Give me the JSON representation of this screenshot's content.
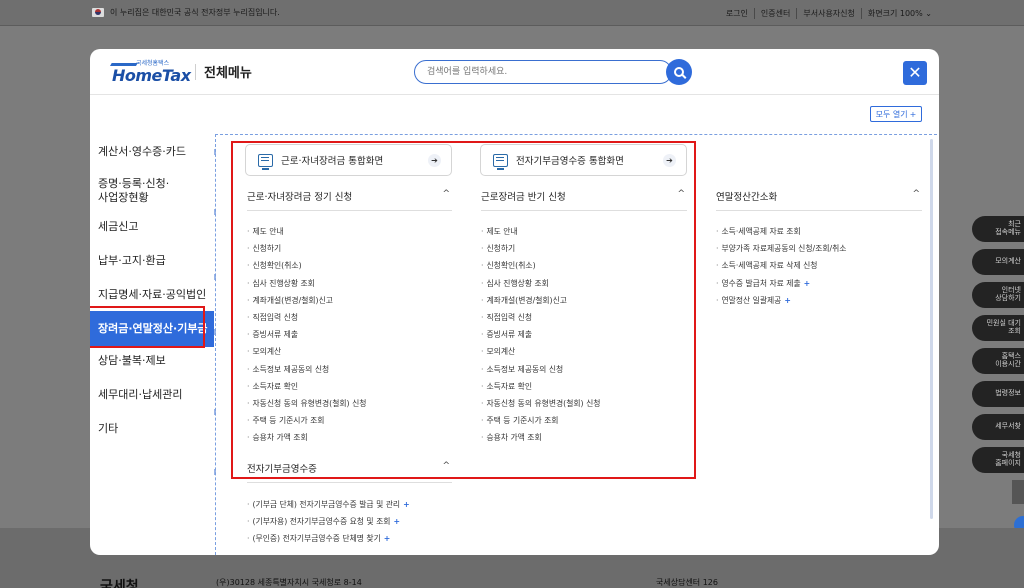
{
  "topbar": {
    "gov_notice": "이 누리집은 대한민국 공식 전자정부 누리집입니다.",
    "links": [
      "로그인",
      "인증센터",
      "부서사용자신청",
      "화면크기 100% ⌄"
    ]
  },
  "modal": {
    "brand_sub": "국세청홈택스",
    "brand_name": "HomeTax",
    "title": "전체메뉴",
    "search_placeholder": "검색어를 입력하세요.",
    "close": "✕",
    "open_all": "모두 열기",
    "open_all_plus": "+"
  },
  "nav": [
    "계산서·영수증·카드",
    "증명·등록·신청·\n사업장현황",
    "세금신고",
    "납부·고지·환급",
    "지급명세·자료·공익법인",
    "장려금·연말정산·기부금",
    "상담·불복·제보",
    "세무대리·납세관리",
    "기타"
  ],
  "cards": {
    "card1": "근로·자녀장려금 통합화면",
    "card2": "전자기부금영수증 통합화면",
    "arrow": "➔"
  },
  "sections": {
    "s1": {
      "title": "근로·자녀장려금 정기 신청",
      "caret": "^",
      "items": [
        "제도 안내",
        "신청하기",
        "신청확인(취소)",
        "심사 진행상황 조회",
        "계좌개설(변경/철회)신고",
        "직접입력 신청",
        "증빙서류 제출",
        "모의계산",
        "소득정보 제공동의 신청",
        "소득자료 확인",
        "자동신청 동의 유형변경(철회) 신청",
        "주택 등 기준시가 조회",
        "승용차 가액 조회"
      ]
    },
    "s2": {
      "title": "근로장려금 반기 신청",
      "caret": "^",
      "items": [
        "제도 안내",
        "신청하기",
        "신청확인(취소)",
        "심사 진행상황 조회",
        "계좌개설(변경/철회)신고",
        "직접입력 신청",
        "증빙서류 제출",
        "모의계산",
        "소득정보 제공동의 신청",
        "소득자료 확인",
        "자동신청 동의 유형변경(철회) 신청",
        "주택 등 기준시가 조회",
        "승용차 가액 조회"
      ]
    },
    "s3": {
      "title": "연말정산간소화",
      "caret": "^",
      "items": [
        "소득·세액공제 자료 조회",
        "부양가족 자료제공동의 신청/조회/취소",
        "소득·세액공제 자료 삭제 신청",
        "영수증 발급처 자료 제출",
        "연말정산 일괄제공"
      ],
      "plus_flags": [
        false,
        false,
        false,
        true,
        true
      ]
    },
    "s4": {
      "title": "전자기부금영수증",
      "caret": "^",
      "items": [
        "(기부금 단체) 전자기부금영수증 발급 및 관리",
        "(기부자용) 전자기부금영수증 요청 및 조회",
        "(무인증) 전자기부금영수증 단체명 찾기"
      ],
      "plus_flags": [
        true,
        true,
        true
      ]
    },
    "plus": "+"
  },
  "quick_menu": [
    "최근\n접속메뉴",
    "모의계산",
    "인터넷\n상담하기",
    "민원실 대기\n조회",
    "홈택스\n이용시간",
    "법령정보",
    "세무서찾",
    "국세청\n홈페이지"
  ],
  "footer": {
    "logo": "국세청",
    "address": "(우)30128 세종특별자치시 국세청로 8-14",
    "center": "국세상담센터 126"
  }
}
